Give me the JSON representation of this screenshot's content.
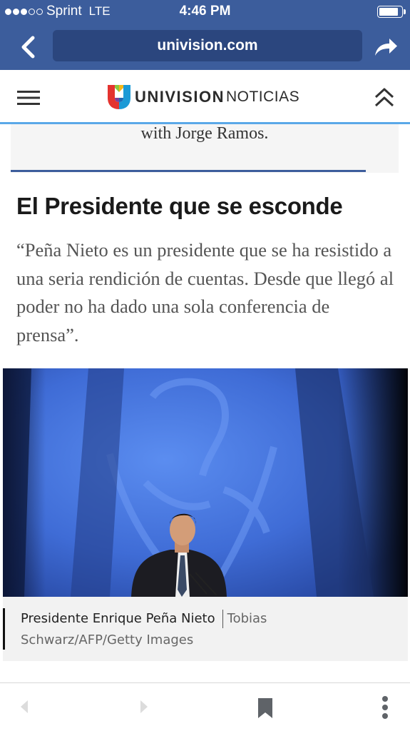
{
  "status_bar": {
    "carrier": "Sprint",
    "network": "LTE",
    "time": "4:46 PM",
    "signal_bars_filled": 3,
    "signal_bars_total": 5,
    "battery_level": 0.9
  },
  "browser": {
    "url": "univision.com",
    "back_icon": "chevron-left-icon",
    "share_icon": "share-arrow-icon"
  },
  "site_header": {
    "brand_main": "UNIVISION",
    "brand_sub": "NOTICIAS",
    "menu_icon": "hamburger-menu-icon",
    "scroll_top_icon": "double-chevron-up-icon"
  },
  "article": {
    "previous_text": "with Jorge Ramos.",
    "headline": "El Presidente que se esconde",
    "quote": "“Peña Nieto es un presidente que se ha resistido a una seria rendición de cuentas. Desde que llegó al poder no ha dado una sola conferencia de prensa”.",
    "caption": "Presidente Enrique Peña Nieto",
    "credit": "Tobias Schwarz/AFP/Getty Images"
  },
  "bottom_bar": {
    "back_icon": "back-arrow-icon",
    "forward_icon": "forward-arrow-icon",
    "bookmark_icon": "bookmark-icon",
    "more_icon": "more-vertical-icon"
  },
  "colors": {
    "status_bar_bg": "#3c5d9c",
    "url_field_bg": "#2b467e",
    "header_accent": "#5aa8e8",
    "section_rule": "#3c5d9c",
    "photo_backdrop": "#4470d8"
  }
}
